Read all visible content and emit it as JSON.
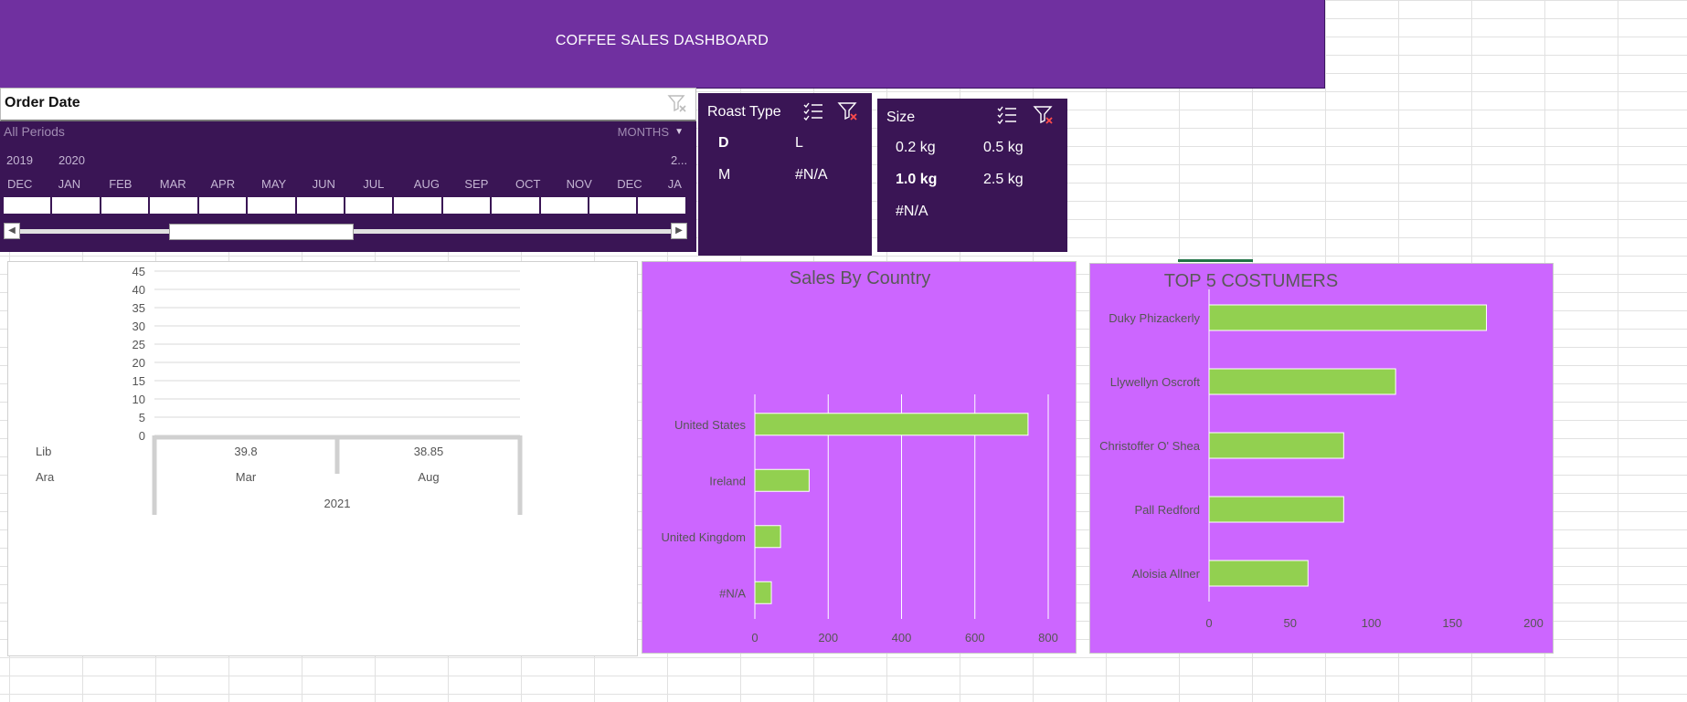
{
  "banner": {
    "title": "COFFEE SALES DASHBOARD"
  },
  "timeline": {
    "title": "Order Date",
    "periods_label": "All Periods",
    "level_label": "MONTHS",
    "years": [
      "2019",
      "2020",
      "2..."
    ],
    "months": [
      "DEC",
      "JAN",
      "FEB",
      "MAR",
      "APR",
      "MAY",
      "JUN",
      "JUL",
      "AUG",
      "SEP",
      "OCT",
      "NOV",
      "DEC",
      "JA"
    ],
    "clear_icon": "clear-filter-icon"
  },
  "roast_slicer": {
    "title": "Roast Type",
    "items": [
      {
        "label": "D",
        "selected": true
      },
      {
        "label": "L",
        "selected": false
      },
      {
        "label": "M",
        "selected": false
      },
      {
        "label": "#N/A",
        "selected": false
      }
    ],
    "icons": [
      "multi-select-icon",
      "clear-filter-icon"
    ]
  },
  "size_slicer": {
    "title": "Size",
    "items": [
      {
        "label": "0.2 kg",
        "selected": false
      },
      {
        "label": "0.5 kg",
        "selected": false
      },
      {
        "label": "1.0 kg",
        "selected": true
      },
      {
        "label": "2.5 kg",
        "selected": false
      },
      {
        "label": "#N/A",
        "selected": false
      }
    ],
    "icons": [
      "multi-select-icon",
      "clear-filter-icon"
    ]
  },
  "colors": {
    "banner": "#7030a0",
    "slicer_bg": "#3a1555",
    "panel_bg": "#cc66ff",
    "bar": "#92d050",
    "bar_border": "#ffffff"
  },
  "chart_data": [
    {
      "type": "table",
      "ylim": [
        0,
        45
      ],
      "yticks": [
        0,
        5,
        10,
        15,
        20,
        25,
        30,
        35,
        40,
        45
      ],
      "grid": true,
      "series": [
        {
          "name": "Lib",
          "values": [
            39.8,
            38.85
          ]
        },
        {
          "name": "Ara",
          "values": [
            null,
            null
          ]
        }
      ],
      "categories": [
        "Mar",
        "Aug"
      ],
      "group_label": "2021",
      "value_labels": [
        "39.8",
        "38.85"
      ]
    },
    {
      "type": "bar",
      "orientation": "horizontal",
      "title": "Sales By Country",
      "categories": [
        "United States",
        "Ireland",
        "United Kingdom",
        "#N/A"
      ],
      "values": [
        745,
        148,
        70,
        45
      ],
      "xlim": [
        0,
        800
      ],
      "xticks": [
        0,
        200,
        400,
        600,
        800
      ],
      "grid": true
    },
    {
      "type": "bar",
      "orientation": "horizontal",
      "title": "TOP 5 COSTUMERS",
      "categories": [
        "Duky Phizackerly",
        "Llywellyn Oscroft",
        "Christoffer O' Shea",
        "Pall Redford",
        "Aloisia Allner"
      ],
      "values": [
        171,
        115,
        83,
        83,
        61
      ],
      "xlim": [
        0,
        200
      ],
      "xticks": [
        0,
        50,
        100,
        150,
        200
      ],
      "grid": false
    }
  ]
}
